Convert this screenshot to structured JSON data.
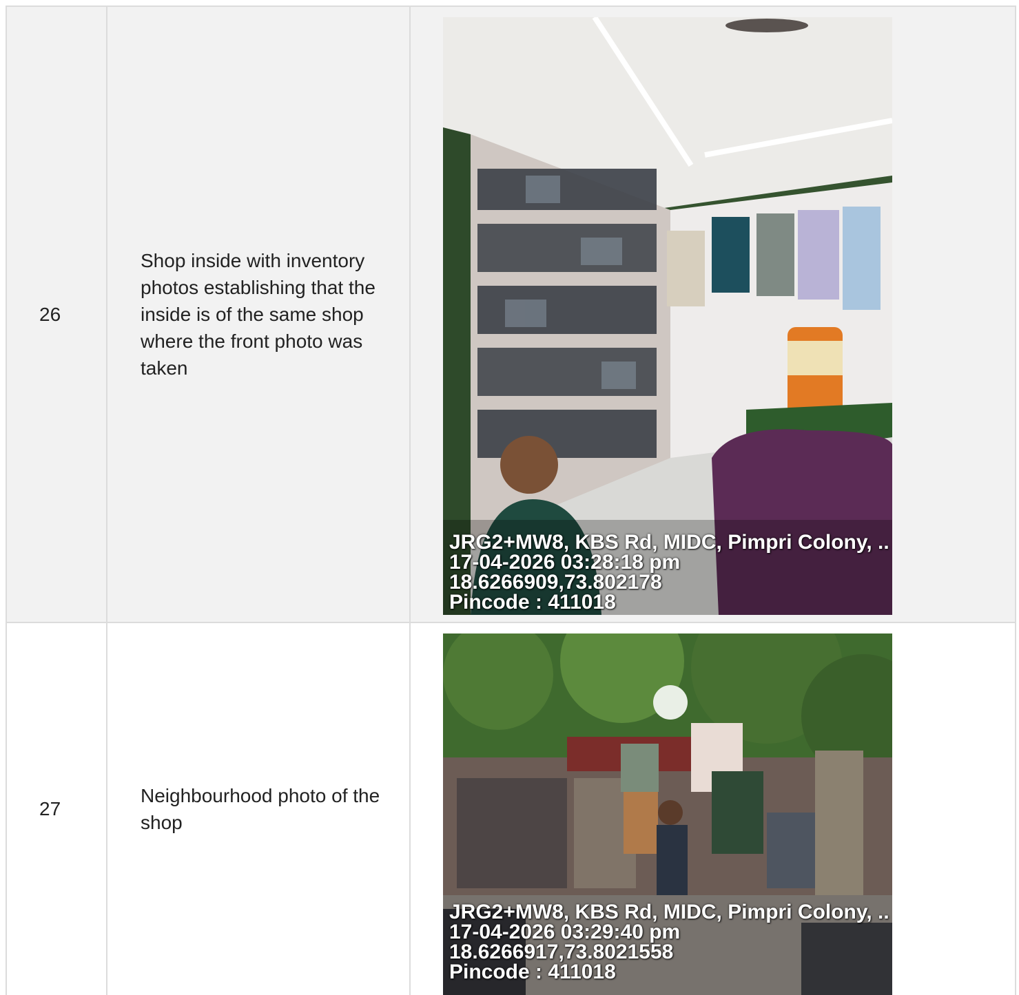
{
  "rows": [
    {
      "number": "26",
      "description": "Shop inside with inventory photos establishing that the inside is of the same shop where the front photo was taken",
      "photo": {
        "subject": "shop-interior-icon",
        "stamp": {
          "address": "JRG2+MW8, KBS Rd, MIDC, Pimpri Colony, ..",
          "datetime": "17-04-2026 03:28:18 pm",
          "coordinates": "18.6266909,73.802178",
          "pincode": "Pincode : 411018"
        }
      }
    },
    {
      "number": "27",
      "description": "Neighbourhood photo of the shop",
      "photo": {
        "subject": "street-shop-icon",
        "stamp": {
          "address": "JRG2+MW8, KBS Rd, MIDC, Pimpri Colony, ..",
          "datetime": "17-04-2026 03:29:40 pm",
          "coordinates": "18.6266917,73.8021558",
          "pincode": "Pincode : 411018"
        }
      }
    }
  ],
  "colors": {
    "border": "#dcdcdc",
    "row_alt_bg": "#f2f2f2",
    "text": "#222222"
  }
}
